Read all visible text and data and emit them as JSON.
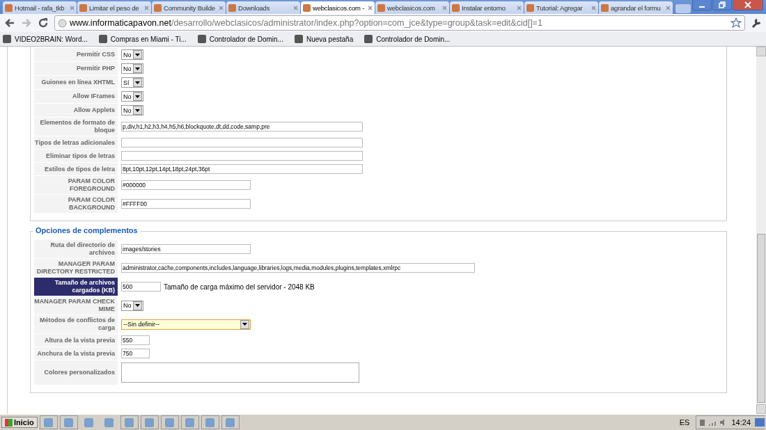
{
  "tabs": [
    {
      "title": "Hotmail - rafa_tkb",
      "selected": false
    },
    {
      "title": "Limitar el peso de",
      "selected": false
    },
    {
      "title": "Community Builde",
      "selected": false
    },
    {
      "title": "Downloads",
      "selected": false
    },
    {
      "title": "webclasicos.com -",
      "selected": true
    },
    {
      "title": "webclasicos.com",
      "selected": false
    },
    {
      "title": "Instalar entorno",
      "selected": false
    },
    {
      "title": "Tutorial: Agregar",
      "selected": false
    },
    {
      "title": "agrandar el formu",
      "selected": false
    }
  ],
  "address": {
    "host": "www.informaticapavon.net",
    "path": "/desarrollo/webclasicos/administrator/index.php?option=com_jce&type=group&task=edit&cid[]=1"
  },
  "bookmarks": [
    "VIDEO2BRAIN: Word...",
    "Compras en Miami - Ti...",
    "Controlador de Domin...",
    "Nueva pestaña",
    "Controlador de Domin..."
  ],
  "sections": [
    {
      "rows": [
        {
          "label": "Permitir CSS",
          "kind": "select",
          "value": "No"
        },
        {
          "label": "Permitir PHP",
          "kind": "select",
          "value": "No"
        },
        {
          "label": "Guiones en línea XHTML",
          "kind": "select",
          "value": "Sí"
        },
        {
          "label": "Allow IFrames",
          "kind": "select",
          "value": "No"
        },
        {
          "label": "Allow Applets",
          "kind": "select",
          "value": "No"
        },
        {
          "label": "Elementos de formato de bloque",
          "kind": "text",
          "value": "p,div,h1,h2,h3,h4,h5,h6,blockquote,dt,dd,code,samp,pre"
        },
        {
          "label": "Tipos de letras adicionales",
          "kind": "text"
        },
        {
          "label": "Eliminar tipos de letras",
          "kind": "text"
        },
        {
          "label": "Estilos de tipos de letra",
          "kind": "text",
          "value": "8pt,10pt,12pt,14pt,18pt,24pt,36pt"
        },
        {
          "label": "PARAM COLOR FOREGROUND",
          "kind": "text",
          "value": "#000000"
        },
        {
          "label": "PARAM COLOR BACKGROUND",
          "kind": "text",
          "value": "#FFFF00"
        }
      ]
    },
    {
      "legend": "Opciones de complementos",
      "rows": [
        {
          "label": "Ruta del directorio de archivos",
          "kind": "text",
          "value": "images/stories"
        },
        {
          "label": "MANAGER PARAM DIRECTORY RESTRICTED",
          "kind": "text",
          "value": "administrator,cache,components,includes,language,libraries,logs,media,modules,plugins,templates,xmlrpc"
        },
        {
          "label": "Tamaño de archivos cargados (KB)",
          "kind": "text",
          "value": "500",
          "note": "Tamaño de carga máximo del servidor - 2048 KB",
          "highlighted": true
        },
        {
          "label": "MANAGER PARAM CHECK MIME",
          "kind": "select",
          "value": "No"
        },
        {
          "label": "Métodos de conflictos de carga",
          "kind": "select",
          "value": "--Sin definir--",
          "focused": true
        },
        {
          "label": "Altura de la vista previa",
          "kind": "text",
          "value": "550"
        },
        {
          "label": "Anchura de la vista previa",
          "kind": "text",
          "value": "750"
        },
        {
          "label": "Colores personalizados",
          "kind": "textarea"
        }
      ]
    }
  ],
  "taskbar": {
    "start": "Inicio",
    "language": "ES",
    "clock": "14:24"
  }
}
